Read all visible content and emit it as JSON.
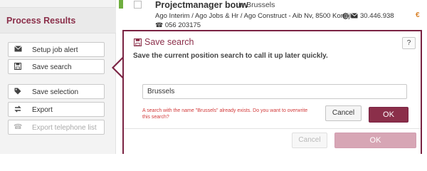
{
  "left_panel": {
    "title": "Process Results",
    "buttons": [
      {
        "label": "Setup job alert",
        "icon": "envelope-icon",
        "disabled": false
      },
      {
        "label": "Save search",
        "icon": "floppy-disk-icon",
        "disabled": false
      },
      {
        "label": "Save selection",
        "icon": "tag-icon",
        "disabled": false
      },
      {
        "label": "Export",
        "icon": "export-arrows-icon",
        "disabled": false
      },
      {
        "label": "Export telephone list",
        "icon": "phone-icon",
        "disabled": true
      }
    ]
  },
  "result": {
    "title": "Projectmanager bouw",
    "location_prefix": "in",
    "location": "Brussels",
    "company": "Ago Interim / Ago Jobs & Hr / Ago Construct - Aib Nv, 8500 Kortrijk",
    "count": "30.446.938",
    "currency": "€",
    "phone": "056 203175",
    "accent_color": "#6fae3f"
  },
  "modal": {
    "title": "Save search",
    "help_label": "?",
    "description": "Save the current position search to call it up later quickly.",
    "input_value": "Brussels",
    "warning": "A search with the name \"Brussels\" already exists. Do you want to overwrite this search?",
    "confirm_cancel_label": "Cancel",
    "confirm_ok_label": "OK",
    "footer_cancel_label": "Cancel",
    "footer_ok_label": "OK",
    "brand_color": "#8b2f4a",
    "warning_color": "#d23a3a"
  }
}
